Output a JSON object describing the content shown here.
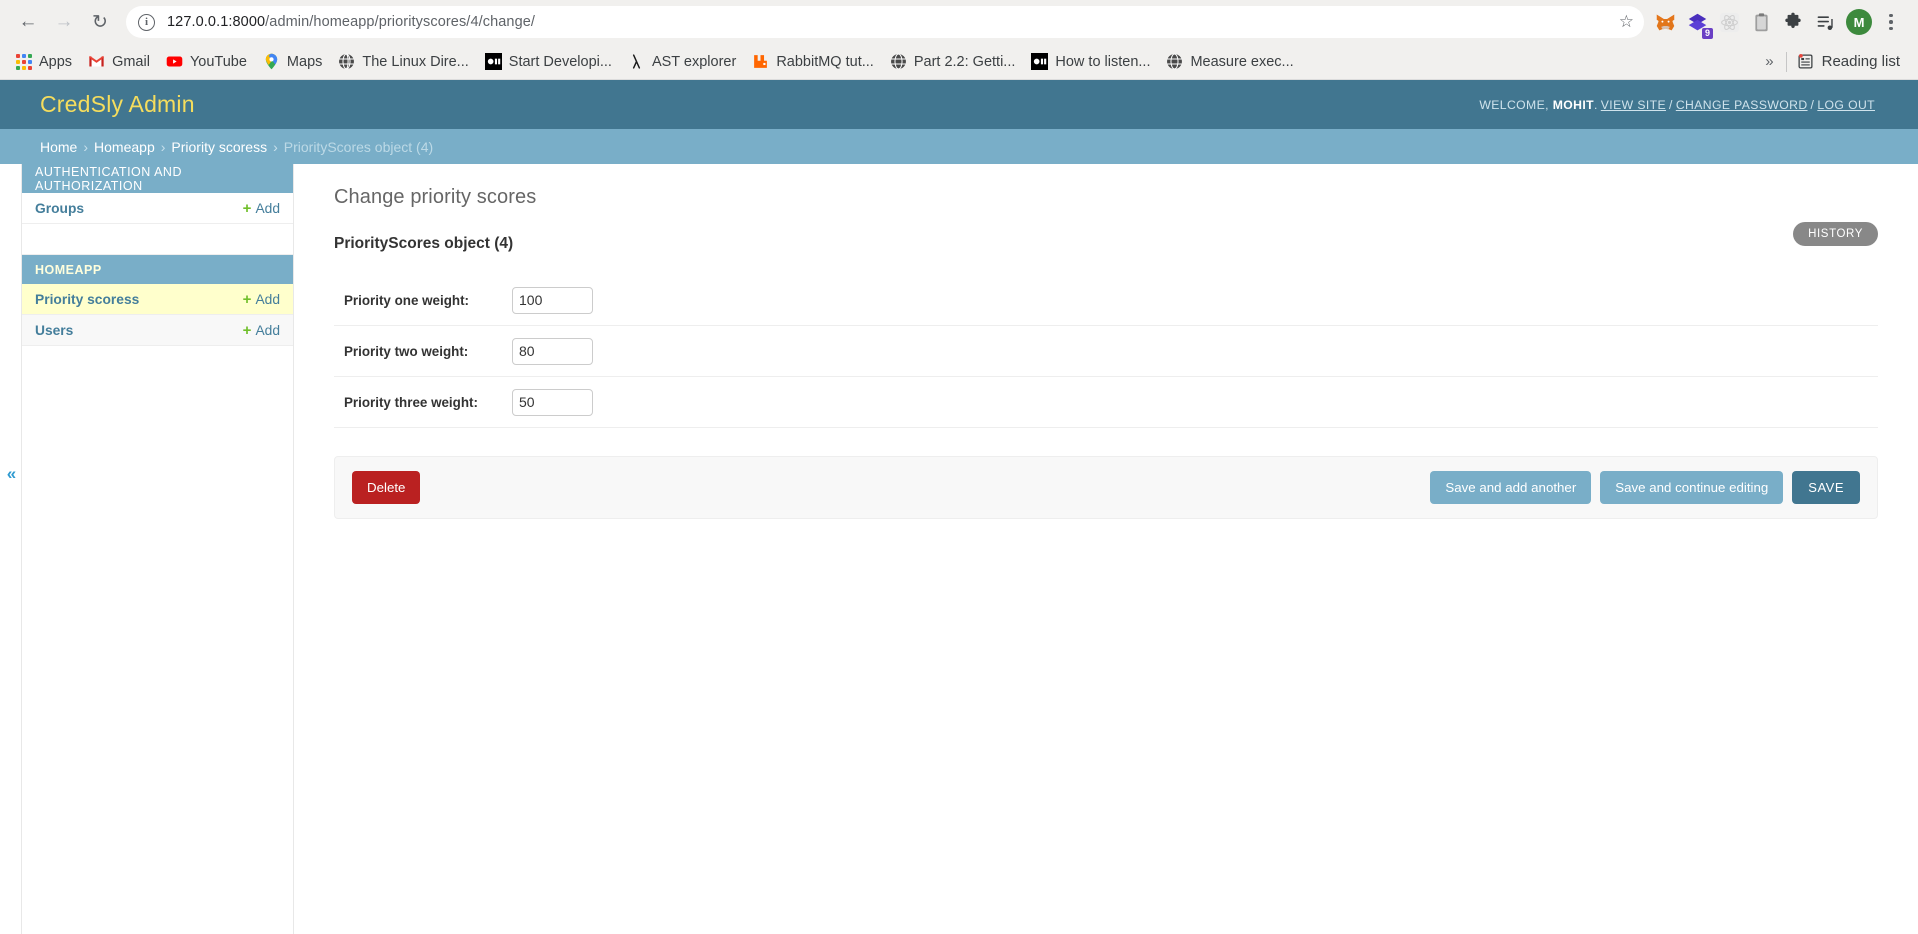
{
  "browser": {
    "nav": {
      "back_icon": "back-arrow-icon",
      "forward_icon": "forward-arrow-icon",
      "reload_icon": "reload-icon"
    },
    "omnibox": {
      "url_prefix": "127.0.0.1:8000",
      "url_path": "/admin/homeapp/priorityscores/4/change/",
      "site_info_icon": "site-info-icon",
      "bookmark_star_icon": "star-icon"
    },
    "extensions": [
      {
        "name": "metamask-extension-icon",
        "badge": ""
      },
      {
        "name": "stacked-layers-extension-icon",
        "badge": "9"
      },
      {
        "name": "react-devtools-extension-icon",
        "badge": ""
      },
      {
        "name": "clipboard-extension-icon",
        "badge": ""
      },
      {
        "name": "extensions-puzzle-icon",
        "badge": ""
      },
      {
        "name": "media-playlist-icon",
        "badge": ""
      }
    ],
    "profile_initial": "M",
    "menu_icon": "three-dot-menu-icon",
    "bookmarks": [
      {
        "label": "Apps",
        "icon": "apps-grid-icon"
      },
      {
        "label": "Gmail",
        "icon": "gmail-icon"
      },
      {
        "label": "YouTube",
        "icon": "youtube-icon"
      },
      {
        "label": "Maps",
        "icon": "maps-pin-icon"
      },
      {
        "label": "The Linux Dire...",
        "icon": "globe-icon"
      },
      {
        "label": "Start Developi...",
        "icon": "black-square-icon"
      },
      {
        "label": "AST explorer",
        "icon": "lambda-icon"
      },
      {
        "label": "RabbitMQ tut...",
        "icon": "rabbitmq-icon"
      },
      {
        "label": "Part 2.2: Getti...",
        "icon": "globe-icon"
      },
      {
        "label": "How to listen...",
        "icon": "black-square-icon"
      },
      {
        "label": "Measure exec...",
        "icon": "globe-icon"
      }
    ],
    "overflow_label": "»",
    "reading_list": {
      "label": "Reading list",
      "icon": "reading-list-icon"
    }
  },
  "admin": {
    "site_title": "CredSly Admin",
    "user_tools": {
      "welcome_prefix": "WELCOME,",
      "username": "MOHIT",
      "period": ".",
      "view_site": "VIEW SITE",
      "separator": "/",
      "change_password": "CHANGE PASSWORD",
      "log_out": "LOG OUT"
    },
    "breadcrumbs": {
      "home": "Home",
      "app": "Homeapp",
      "model": "Priority scoress",
      "current": "PriorityScores object (4)",
      "separator": "›"
    },
    "sidebar": {
      "toggle_icon": "«",
      "groups": [
        {
          "caption": "AUTHENTICATION AND AUTHORIZATION",
          "models": [
            {
              "name": "Groups",
              "add_label": "Add",
              "current": false
            }
          ]
        },
        {
          "caption": "HOMEAPP",
          "models": [
            {
              "name": "Priority scoress",
              "add_label": "Add",
              "current": true
            },
            {
              "name": "Users",
              "add_label": "Add",
              "current": false
            }
          ]
        }
      ]
    },
    "content": {
      "title": "Change priority scores",
      "history_label": "HISTORY",
      "object_name": "PriorityScores object (4)",
      "fields": [
        {
          "label": "Priority one weight:",
          "value": "100"
        },
        {
          "label": "Priority two weight:",
          "value": "80"
        },
        {
          "label": "Priority three weight:",
          "value": "50"
        }
      ],
      "buttons": {
        "delete": "Delete",
        "save_and_add_another": "Save and add another",
        "save_and_continue": "Save and continue editing",
        "save": "SAVE"
      }
    }
  },
  "colors": {
    "header_bg": "#417690",
    "header_title": "#f5dd5d",
    "breadcrumb_bg": "#79aec8",
    "accent_light": "#79aec8",
    "link": "#447e9b",
    "delete_red": "#ba2121",
    "add_green": "#70bf2b",
    "selected_row": "#ffffcc",
    "history_gray": "#888888"
  }
}
